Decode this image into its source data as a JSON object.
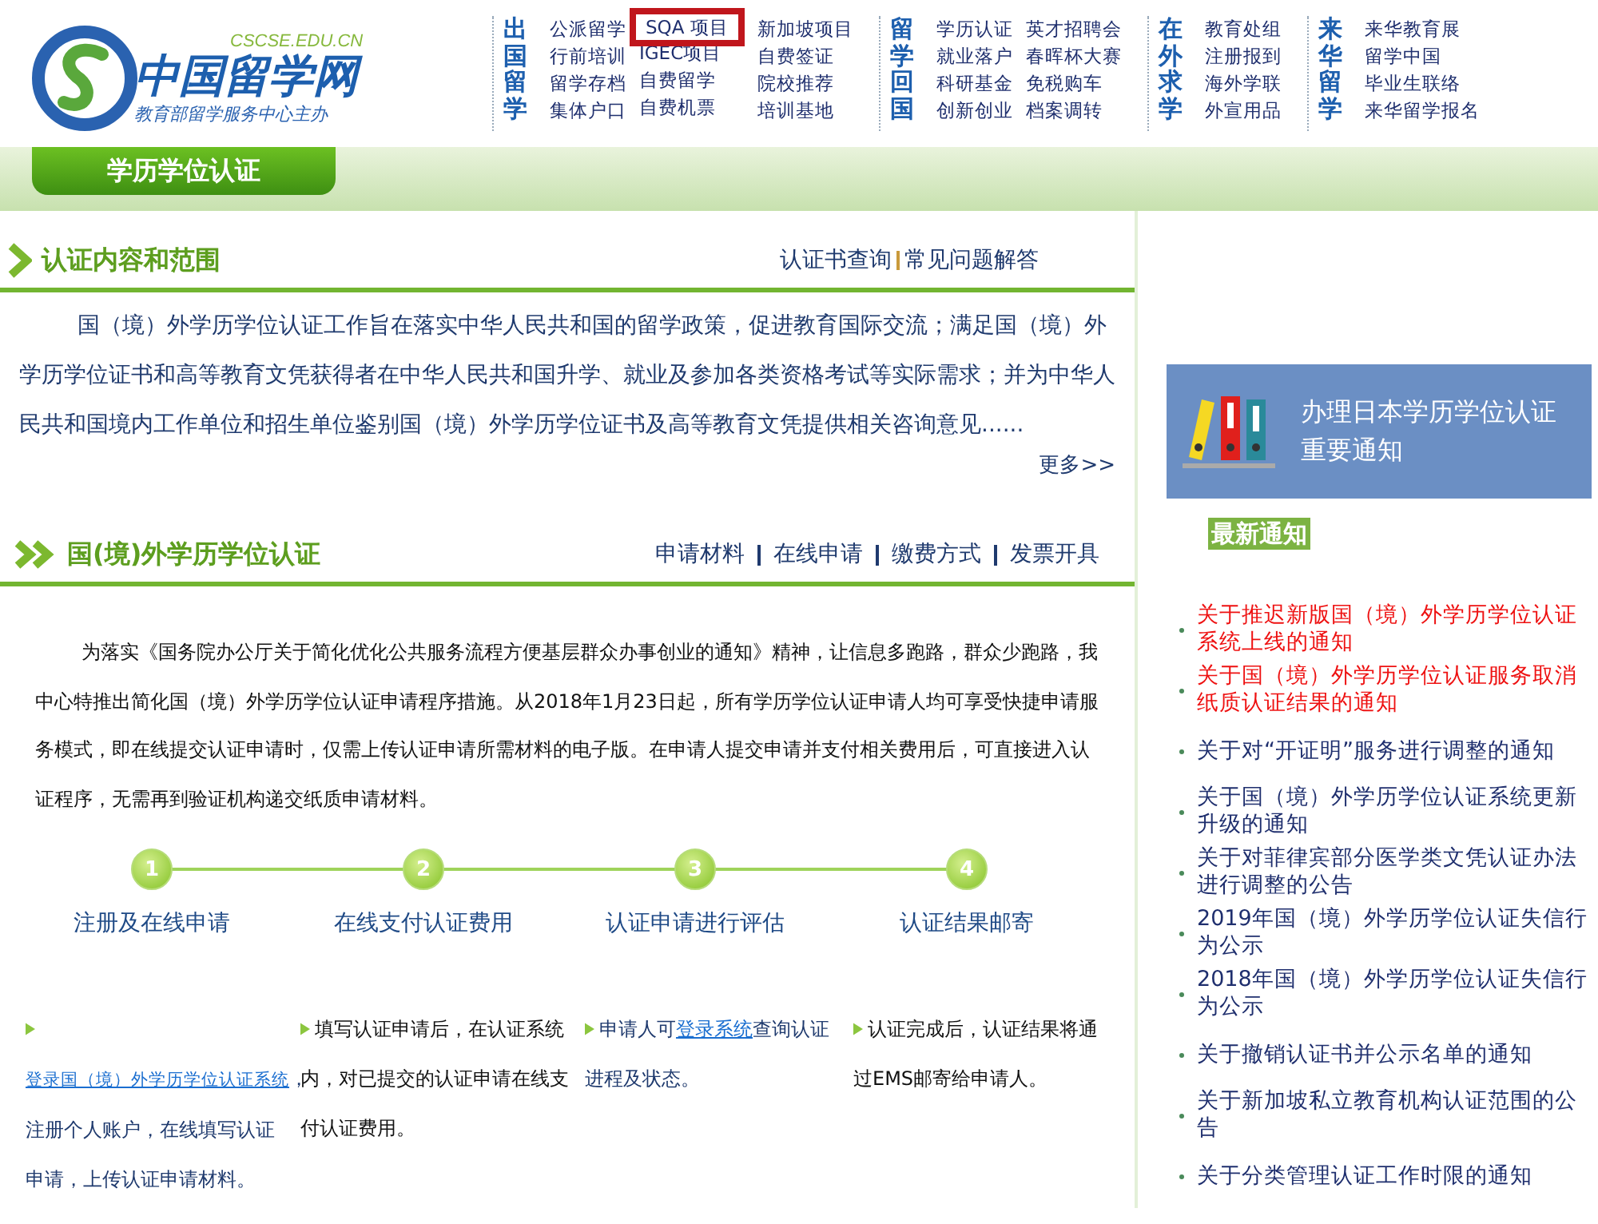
{
  "header": {
    "logo": {
      "domain": "CSCSE.EDU.CN",
      "name": "中国留学网",
      "slogan": "教育部留学服务中心主办"
    },
    "nav_groups": [
      {
        "title": "出国留学",
        "columns": [
          [
            {
              "text": "公派留学",
              "highlighted": false
            },
            {
              "text": "行前培训",
              "highlighted": false
            },
            {
              "text": "留学存档",
              "highlighted": false
            },
            {
              "text": "集体户口",
              "highlighted": false
            }
          ],
          [
            {
              "text": "SQA 项目",
              "highlighted": true
            },
            {
              "text": "IGEC项目",
              "highlighted": false
            },
            {
              "text": "自费留学",
              "highlighted": false
            },
            {
              "text": "自费机票",
              "highlighted": false
            }
          ],
          [
            {
              "text": "新加坡项目",
              "highlighted": false
            },
            {
              "text": "自费签证",
              "highlighted": false
            },
            {
              "text": "院校推荐",
              "highlighted": false
            },
            {
              "text": "培训基地",
              "highlighted": false
            }
          ]
        ]
      },
      {
        "title": "留学回国",
        "columns": [
          [
            {
              "text": "学历认证",
              "highlighted": false
            },
            {
              "text": "就业落户",
              "highlighted": false
            },
            {
              "text": "科研基金",
              "highlighted": false
            },
            {
              "text": "创新创业",
              "highlighted": false
            }
          ],
          [
            {
              "text": "英才招聘会",
              "highlighted": false
            },
            {
              "text": "春晖杯大赛",
              "highlighted": false
            },
            {
              "text": "免税购车",
              "highlighted": false
            },
            {
              "text": "档案调转",
              "highlighted": false
            }
          ]
        ]
      },
      {
        "title": "在外求学",
        "columns": [
          [
            {
              "text": "教育处组",
              "highlighted": false
            },
            {
              "text": "注册报到",
              "highlighted": false
            },
            {
              "text": "海外学联",
              "highlighted": false
            },
            {
              "text": "外宣用品",
              "highlighted": false
            }
          ]
        ]
      },
      {
        "title": "来华留学",
        "columns": [
          [
            {
              "text": "来华教育展",
              "highlighted": false
            },
            {
              "text": "留学中国",
              "highlighted": false
            },
            {
              "text": "毕业生联络",
              "highlighted": false
            },
            {
              "text": "来华留学报名",
              "highlighted": false
            }
          ]
        ]
      }
    ]
  },
  "banner": {
    "title": "学历学位认证"
  },
  "intro_section": {
    "title": "认证内容和范围",
    "links": [
      "认证书查询",
      "常见问题解答"
    ],
    "paragraph": "国（境）外学历学位认证工作旨在落实中华人民共和国的留学政策，促进教育国际交流；满足国（境）外学历学位证书和高等教育文凭获得者在中华人民共和国升学、就业及参加各类资格考试等实际需求；并为中华人民共和国境内工作单位和招生单位鉴别国（境）外学历学位证书及高等教育文凭提供相关咨询意见......",
    "more": "更多>>"
  },
  "apply_section": {
    "title": "国(境)外学历学位认证",
    "links": [
      "申请材料",
      "在线申请",
      "缴费方式",
      "发票开具"
    ],
    "paragraph": "为落实《国务院办公厅关于简化优化公共服务流程方便基层群众办事创业的通知》精神，让信息多跑路，群众少跑路，我中心特推出简化国（境）外学历学位认证申请程序措施。从2018年1月23日起，所有学历学位认证申请人均可享受快捷申请服务模式，即在线提交认证申请时，仅需上传认证申请所需材料的电子版。在申请人提交申请并支付相关费用后，可直接进入认证程序，无需再到验证机构递交纸质申请材料。",
    "steps": [
      {
        "number": "1",
        "label": "注册及在线申请"
      },
      {
        "number": "2",
        "label": "在线支付认证费用"
      },
      {
        "number": "3",
        "label": "认证申请进行评估"
      },
      {
        "number": "4",
        "label": "认证结果邮寄"
      }
    ],
    "notes": [
      [
        {
          "text": "登录国（境）外学历学位认证系统",
          "kind": "link"
        },
        {
          "text": "，注册个人账户，在线填写认证申请，上传认证申请材料。",
          "kind": "text"
        }
      ],
      [
        {
          "text": "填写认证申请后，在认证系统内，对已提交的认证申请在线支付认证费用。",
          "kind": "text"
        }
      ],
      [
        {
          "text": "申请人可",
          "kind": "text"
        },
        {
          "text": "登录系统",
          "kind": "link"
        },
        {
          "text": "查询认证进程及状态。",
          "kind": "text"
        }
      ],
      [
        {
          "text": "认证完成后，认证结果将通过EMS邮寄给申请人。",
          "kind": "text"
        }
      ]
    ]
  },
  "sidebar": {
    "promo": {
      "title": "办理日本学历学位认证",
      "subtitle": "重要通知"
    },
    "news_heading": "最新通知",
    "notices": [
      {
        "text": "关于推迟新版国（境）外学历学位认证系统上线的通知",
        "urgent": true
      },
      {
        "text": "关于国（境）外学历学位认证服务取消纸质认证结果的通知",
        "urgent": true
      },
      {
        "text": "关于对“开证明”服务进行调整的通知",
        "urgent": false
      },
      {
        "text": "关于国（境）外学历学位认证系统更新升级的通知",
        "urgent": false
      },
      {
        "text": "关于对菲律宾部分医学类文凭认证办法进行调整的公告",
        "urgent": false
      },
      {
        "text": "2019年国（境）外学历学位认证失信行为公示",
        "urgent": false
      },
      {
        "text": "2018年国（境）外学历学位认证失信行为公示",
        "urgent": false
      },
      {
        "text": "关于撤销认证书并公示名单的通知",
        "urgent": false
      },
      {
        "text": "关于新加坡私立教育机构认证范围的公告",
        "urgent": false
      },
      {
        "text": "关于分类管理认证工作时限的通知",
        "urgent": false
      }
    ]
  }
}
